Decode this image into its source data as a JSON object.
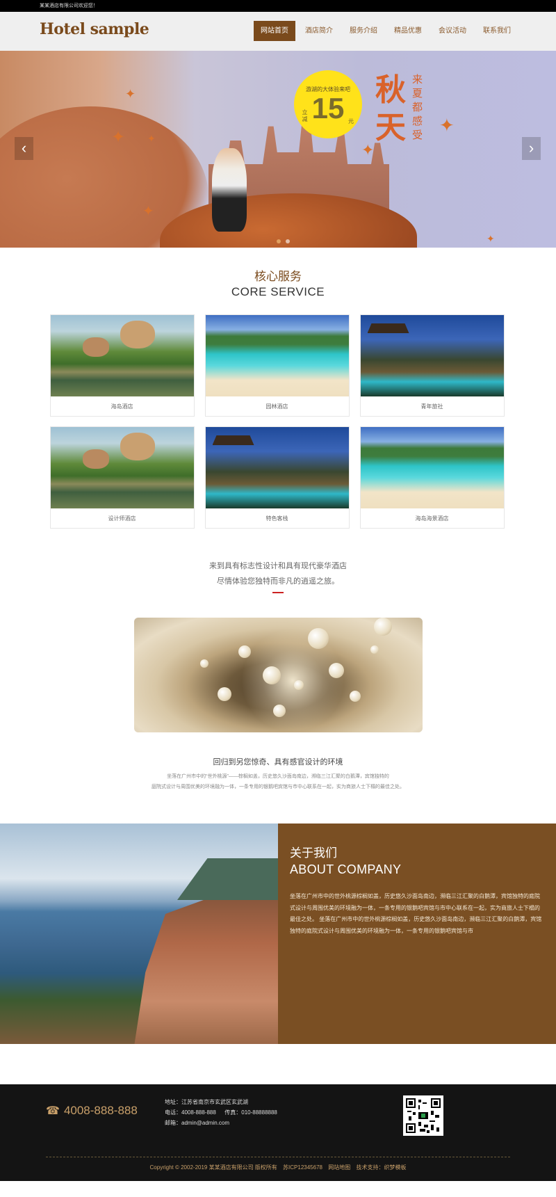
{
  "topbar": {
    "welcome": "某某酒店有限公司欢迎您！"
  },
  "header": {
    "logo": "Hotel sample",
    "nav": [
      {
        "label": "网站首页"
      },
      {
        "label": "酒店简介"
      },
      {
        "label": "服务介绍"
      },
      {
        "label": "精品优惠"
      },
      {
        "label": "会议活动"
      },
      {
        "label": "联系我们"
      }
    ]
  },
  "banner": {
    "promo_top": "游湖的大体验来吧",
    "promo_prefix": "立减",
    "promo_number": "15",
    "promo_suffix": "元",
    "headline": "秋天",
    "subline": "来夏都感受",
    "prev_glyph": "‹",
    "next_glyph": "›"
  },
  "core": {
    "title_cn": "核心服务",
    "title_en": "CORE SERVICE",
    "items": [
      {
        "label": "海岛酒店",
        "photo": "tulou-village"
      },
      {
        "label": "园林酒店",
        "photo": "tropical-beach"
      },
      {
        "label": "青年旅社",
        "photo": "pool-villa"
      },
      {
        "label": "设计师酒店",
        "photo": "tulou-village"
      },
      {
        "label": "特色客栈",
        "photo": "pool-villa"
      },
      {
        "label": "海岛海景酒店",
        "photo": "tropical-beach"
      }
    ]
  },
  "intro": {
    "line1": "来到具有标志性设计和具有现代豪华酒店",
    "line2": "尽情体验您独特而非凡的逍遥之旅。",
    "title2": "回归到另您惊奇、具有感官设计的环境",
    "desc1": "坐落在广州市中的“世外桃源”——棕榈如盖，历史悠久沙面岛南边，濒临三江汇聚的白鹅潭，宾馆独特的",
    "desc2": "庭院式设计与周围优美的环境融为一体，一条专用的银鹅吧宾馆与市中心联系在一起，实为商旅人士下榻的最佳之处。"
  },
  "about": {
    "title_cn": "关于我们",
    "title_en": "ABOUT COMPANY",
    "body": "坐落在广州市中的世外桃源棕榈如盖，历史悠久沙面岛南边，濒临三江汇聚的白鹅潭，宾馆独特的庭院式设计与周围优美的环境融为一体，一条专用的银鹅吧宾馆与市中心联系在一起，实为商旅人士下榻的最佳之处。 坐落在广州市中的世外桃源棕榈如盖，历史悠久沙面岛南边，濒临三江汇聚的白鹅潭，宾馆独特的庭院式设计与周围优美的环境融为一体，一条专用的银鹅吧宾馆与市"
  },
  "footer": {
    "phone": "4008-888-888",
    "address": "地址：江苏省南京市玄武区玄武湖",
    "tel_fax": "电话：4008-888-888 　 传真：010-88888888",
    "email": "邮箱：admin@admin.com",
    "copyright": "Copyright © 2002-2019 某某酒店有限公司 版权所有",
    "icp": "苏ICP12345678",
    "sitemap": "网站地图",
    "support": "技术支持：织梦模板"
  },
  "colors": {
    "brand": "#7a4a1c",
    "about_bg": "#7a4f23",
    "footer_bg": "#141414",
    "accent_red": "#cc2222"
  }
}
